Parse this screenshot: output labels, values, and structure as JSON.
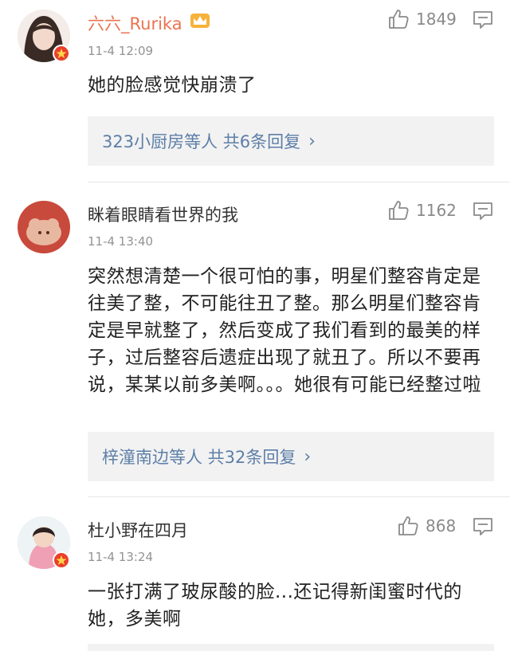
{
  "comments": [
    {
      "username": "六六_Rurika",
      "vip": true,
      "verified": true,
      "timestamp": "11-4 12:09",
      "likes": "1849",
      "text": "她的脸感觉快崩溃了",
      "replies_label": "323小厨房等人  共6条回复"
    },
    {
      "username": "眯着眼睛看世界的我",
      "vip": false,
      "verified": false,
      "timestamp": "11-4 13:40",
      "likes": "1162",
      "text": "突然想清楚一个很可怕的事，明星们整容肯定是往美了整，不可能往丑了整。那么明星们整容肯定是早就整了，然后变成了我们看到的最美的样子，过后整容后遗症出现了就丑了。所以不要再说，某某以前多美啊。。。她很有可能已经整过啦",
      "replies_label": "梓潼南边等人  共32条回复"
    },
    {
      "username": "杜小野在四月",
      "vip": false,
      "verified": true,
      "timestamp": "11-4 13:24",
      "likes": "868",
      "text": "一张打满了玻尿酸的脸...还记得新闺蜜时代的她，多美啊",
      "replies_label": ""
    }
  ],
  "colors": {
    "vip_name": "#eb7350",
    "link": "#5d7fa8",
    "badge": "#e8402b"
  },
  "icons": {
    "like": "thumbs-up-icon",
    "reply": "comment-bubble-icon",
    "more": "chevron-right-icon",
    "vip": "crown-icon",
    "verified": "verified-badge-icon"
  }
}
